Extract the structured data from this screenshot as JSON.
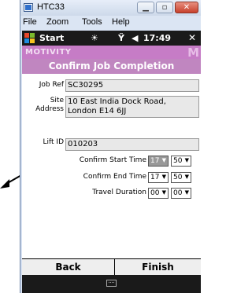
{
  "window": {
    "title": "HTC33",
    "controls": [
      "minimize",
      "maximize",
      "close"
    ]
  },
  "menu": {
    "items": [
      "File",
      "Zoom",
      "Tools",
      "Help"
    ]
  },
  "statusbar": {
    "start_label": "Start",
    "time": "17:49",
    "close_glyph": "✕"
  },
  "brand": {
    "name": "MOTIVITY",
    "logo_letter": "M"
  },
  "form": {
    "heading": "Confirm Job Completion",
    "job_ref_label": "Job Ref",
    "job_ref_value": "SC30295",
    "site_label_1": "Site",
    "site_label_2": "Address",
    "site_value": "10 East India Dock Road, London E14 6JJ",
    "lift_id_label": "Lift ID",
    "lift_id_value": "010203",
    "start_time_label": "Confirm Start Time",
    "start_hour": "17",
    "start_min": "50",
    "end_time_label": "Confirm End Time",
    "end_hour": "17",
    "end_min": "50",
    "travel_label": "Travel Duration",
    "travel_hour": "00",
    "travel_min": "00"
  },
  "softkeys": {
    "left": "Back",
    "right": "Finish"
  }
}
